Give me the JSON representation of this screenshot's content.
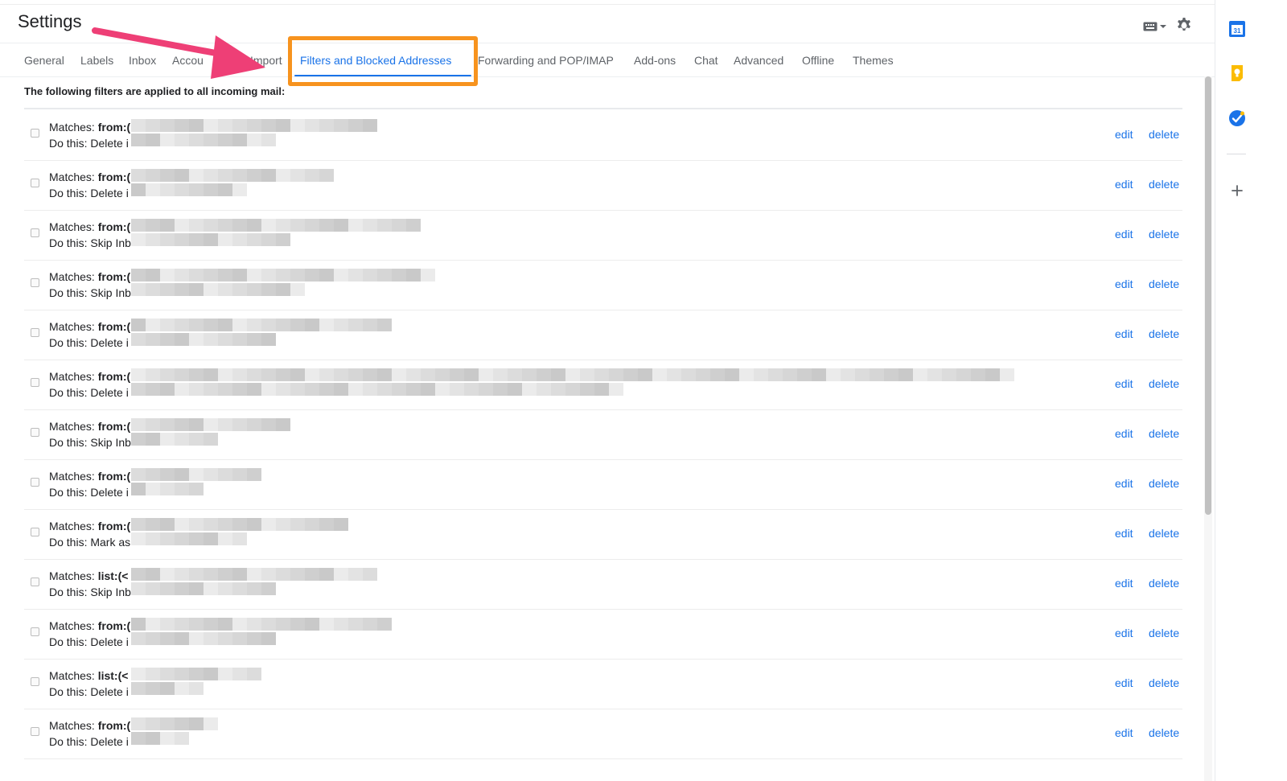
{
  "header": {
    "title": "Settings",
    "icons": [
      "keyboard-icon",
      "gear-icon"
    ]
  },
  "tabs": [
    {
      "label": "General",
      "active": false
    },
    {
      "label": "Labels",
      "active": false
    },
    {
      "label": "Inbox",
      "active": false
    },
    {
      "label": "Accou",
      "active": false
    },
    {
      "label": "Import",
      "active": false
    },
    {
      "label": "Filters and Blocked Addresses",
      "active": true
    },
    {
      "label": "Forwarding and POP/IMAP",
      "active": false
    },
    {
      "label": "Add-ons",
      "active": false
    },
    {
      "label": "Chat",
      "active": false
    },
    {
      "label": "Advanced",
      "active": false
    },
    {
      "label": "Offline",
      "active": false
    },
    {
      "label": "Themes",
      "active": false
    }
  ],
  "filters": {
    "heading": "The following filters are applied to all incoming mail:",
    "matches_prefix": "Matches:",
    "action_prefix": "Do this:",
    "edit_label": "edit",
    "delete_label": "delete",
    "rows": [
      {
        "criterion": "from:(",
        "action": "Delete i"
      },
      {
        "criterion": "from:(",
        "action": "Delete i"
      },
      {
        "criterion": "from:(",
        "action": "Skip Inb"
      },
      {
        "criterion": "from:(",
        "action": "Skip Inb"
      },
      {
        "criterion": "from:(",
        "action": "Delete i"
      },
      {
        "criterion": "from:(",
        "action": "Delete i"
      },
      {
        "criterion": "from:(",
        "action": "Skip Inb"
      },
      {
        "criterion": "from:(",
        "action": "Delete i"
      },
      {
        "criterion": "from:(",
        "action": "Mark as"
      },
      {
        "criterion": "list:(<",
        "action": "Skip Inb"
      },
      {
        "criterion": "from:(",
        "action": "Delete i"
      },
      {
        "criterion": "list:(<",
        "action": "Delete i"
      },
      {
        "criterion": "from:(",
        "action": "Delete i"
      }
    ]
  },
  "side_panel": {
    "icons": [
      "calendar-icon",
      "keep-icon",
      "tasks-icon",
      "add-icon"
    ],
    "calendar_day": "31"
  },
  "colors": {
    "accent": "#1a73e8",
    "highlight": "#f7931e",
    "arrow": "#ee3f76"
  }
}
